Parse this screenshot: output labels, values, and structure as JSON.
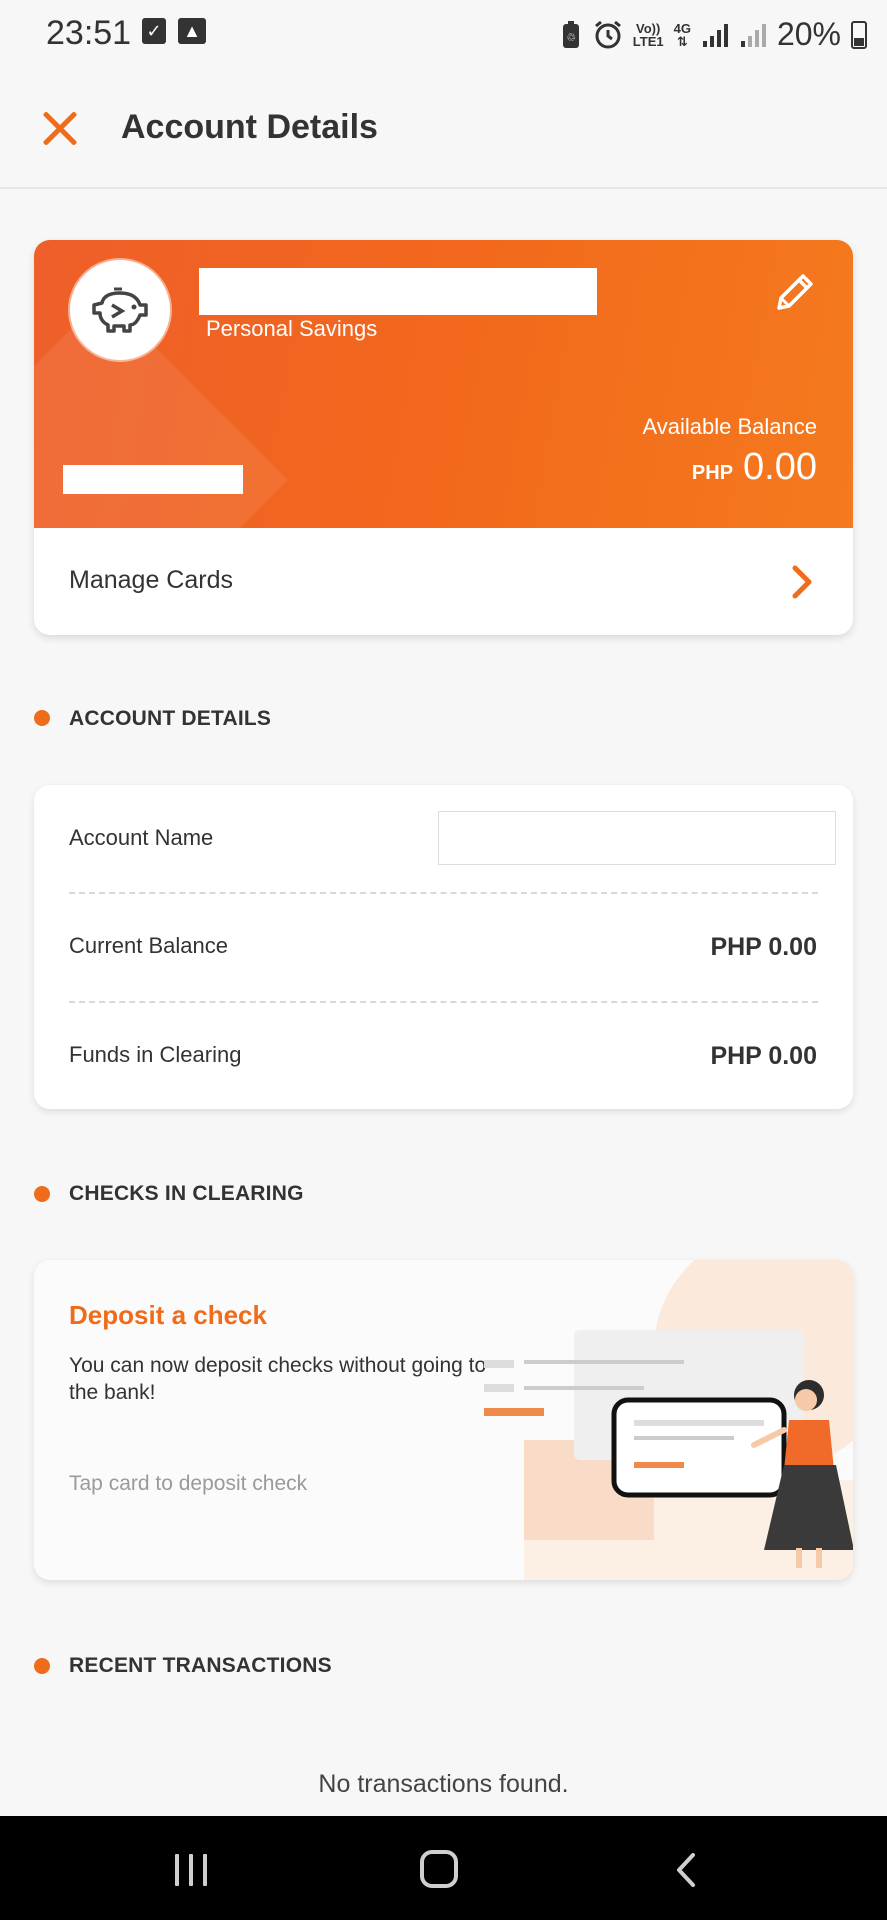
{
  "status_bar": {
    "time": "23:51",
    "battery_percent": "20%",
    "network_label_top": "Vo))",
    "network_label_bottom": "LTE1",
    "data_label": "4G",
    "icons": [
      "checkbox-icon",
      "image-icon",
      "battery-saver-icon",
      "alarm-icon",
      "signal-icon",
      "battery-icon"
    ]
  },
  "header": {
    "title": "Account Details"
  },
  "account_card": {
    "account_type": "Personal Savings",
    "balance_label": "Available Balance",
    "balance_currency": "PHP",
    "balance_value": "0.00",
    "manage_label": "Manage Cards"
  },
  "sections": {
    "account_details": "ACCOUNT DETAILS",
    "checks_in_clearing": "CHECKS IN CLEARING",
    "recent_transactions": "RECENT TRANSACTIONS"
  },
  "details": {
    "rows": [
      {
        "label": "Account Name",
        "value": ""
      },
      {
        "label": "Current Balance",
        "value": "PHP 0.00"
      },
      {
        "label": "Funds in Clearing",
        "value": "PHP 0.00"
      }
    ]
  },
  "deposit": {
    "title": "Deposit a check",
    "description": "You can now deposit checks without going to the bank!",
    "hint": "Tap card to deposit check"
  },
  "transactions": {
    "empty_message": "No transactions found."
  },
  "colors": {
    "accent": "#ef6c1a",
    "card_gradient_start": "#ee5f2a",
    "card_gradient_end": "#f47a1e"
  }
}
